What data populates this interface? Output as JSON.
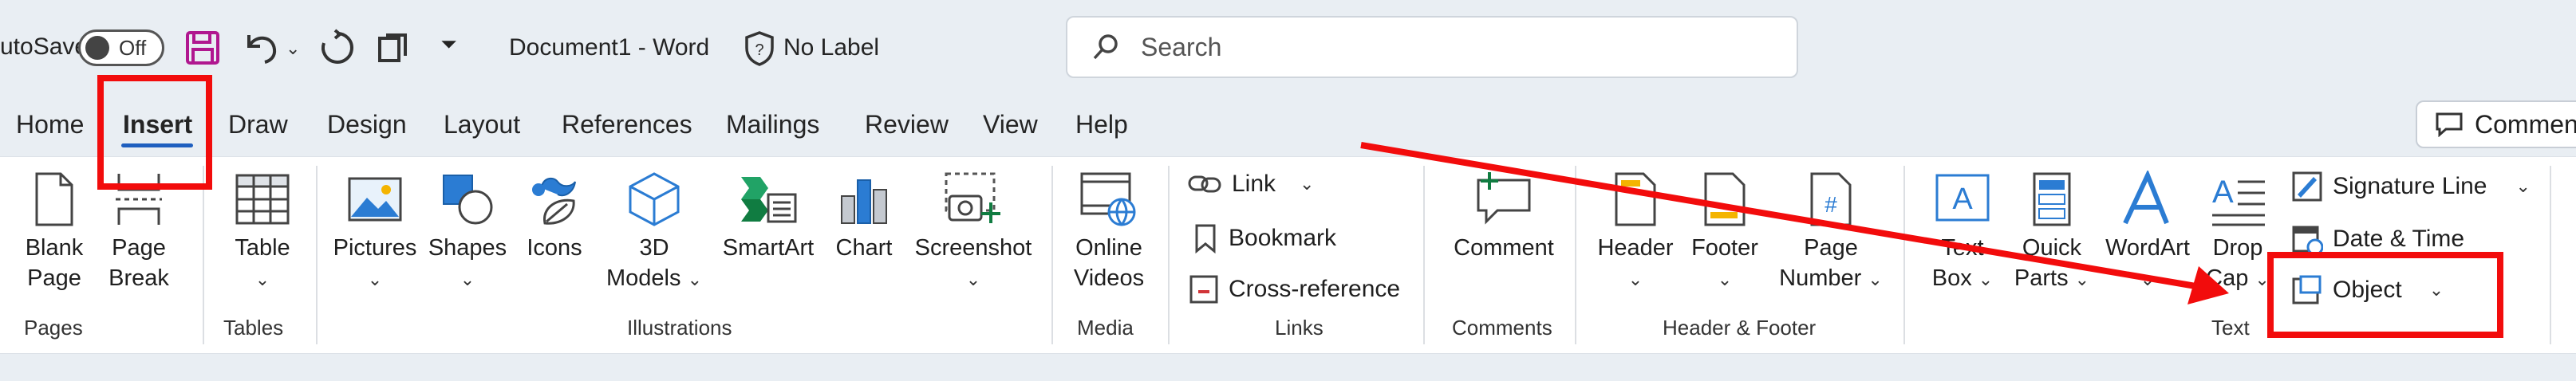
{
  "titlebar": {
    "autosave_label": "utoSave",
    "autosave_state": "Off",
    "document_title": "Document1  -  Word",
    "sensitivity_label": "No Label"
  },
  "search": {
    "placeholder": "Search"
  },
  "tabs": [
    {
      "label": "Home"
    },
    {
      "label": "Insert"
    },
    {
      "label": "Draw"
    },
    {
      "label": "Design"
    },
    {
      "label": "Layout"
    },
    {
      "label": "References"
    },
    {
      "label": "Mailings"
    },
    {
      "label": "Review"
    },
    {
      "label": "View"
    },
    {
      "label": "Help"
    }
  ],
  "comments_button": "Comments",
  "ribbon": {
    "pages": {
      "blank": "Blank",
      "page": "Page",
      "page2": "Page",
      "break": "Break",
      "group": "Pages"
    },
    "tables": {
      "table": "Table",
      "group": "Tables"
    },
    "illustrations": {
      "pictures": "Pictures",
      "shapes": "Shapes",
      "icons": "Icons",
      "d3": "3D",
      "models": "Models",
      "smartart": "SmartArt",
      "chart": "Chart",
      "screenshot": "Screenshot",
      "group": "Illustrations"
    },
    "media": {
      "online": "Online",
      "videos": "Videos",
      "group": "Media"
    },
    "links": {
      "link": "Link",
      "bookmark": "Bookmark",
      "cross_reference": "Cross-reference",
      "group": "Links"
    },
    "comments": {
      "comment": "Comment",
      "group": "Comments"
    },
    "header_footer": {
      "header": "Header",
      "footer": "Footer",
      "page": "Page",
      "number": "Number",
      "group": "Header & Footer"
    },
    "text": {
      "text": "Text",
      "box": "Box",
      "quick": "Quick",
      "parts": "Parts",
      "wordart": "WordArt",
      "drop": "Drop",
      "cap": "Cap",
      "signature_line": "Signature Line",
      "date_time": "Date & Time",
      "object": "Object",
      "group": "Text"
    }
  },
  "colors": {
    "annotation": "#f20c0c",
    "accent": "#1f5fbf",
    "ribbon_bg": "#ffffff",
    "titlebar_bg": "#e9eef3"
  }
}
